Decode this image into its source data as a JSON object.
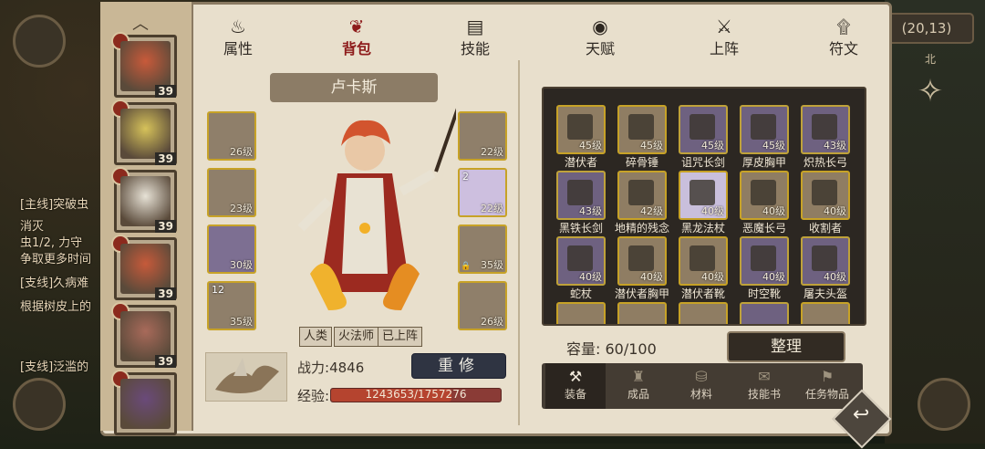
{
  "colors": {
    "gold_border": "#c7a227",
    "purple_slot": "#7d6f92",
    "active_tab": "#8e1c1c",
    "exp_bar": "#b5442f"
  },
  "hud": {
    "coordinates": "(20,13)",
    "north": "北"
  },
  "background_quests": [
    {
      "text": "[主线]突破虫",
      "cls": ""
    },
    {
      "text": "消灭",
      "cls": ""
    },
    {
      "text": "虫1/2, 力守",
      "cls": ""
    },
    {
      "text": "争取更多时间",
      "cls": ""
    },
    {
      "text": "[支线]久病难",
      "cls": ""
    },
    {
      "text": "根据树皮上的",
      "cls": ""
    },
    {
      "text": "[支线]泛滥的",
      "cls": ""
    }
  ],
  "tabs": [
    {
      "label": "属性",
      "icon": "flame-icon",
      "glyph": "♨",
      "active": false
    },
    {
      "label": "背包",
      "icon": "bag-icon",
      "glyph": "❦",
      "active": true
    },
    {
      "label": "技能",
      "icon": "book-icon",
      "glyph": "▤",
      "active": false
    },
    {
      "label": "天赋",
      "icon": "eye-icon",
      "glyph": "◉",
      "active": false
    },
    {
      "label": "上阵",
      "icon": "crossed-swords-icon",
      "glyph": "⚔",
      "active": false
    },
    {
      "label": "符文",
      "icon": "rune-icon",
      "glyph": "۩",
      "active": false
    }
  ],
  "heroes": [
    {
      "level": "39",
      "face_color": "#c85a3a"
    },
    {
      "level": "39",
      "face_color": "#d6c25a"
    },
    {
      "level": "39",
      "face_color": "#e7e2d6"
    },
    {
      "level": "39",
      "face_color": "#c65a3a"
    },
    {
      "level": "39",
      "face_color": "#a86a5a"
    },
    {
      "level": "",
      "face_color": "#6a4a7a"
    }
  ],
  "character": {
    "name": "卢卡斯",
    "tags": [
      "人类",
      "火法师",
      "已上阵"
    ],
    "power_label": "战力:",
    "power_value": "4846",
    "exp_label": "经验:",
    "exp_text": "1243653/1757276",
    "exp_ratio": 0.7077,
    "rebuild_button": "重修"
  },
  "equip_left": [
    {
      "level": "26级",
      "num": "",
      "style": "gold",
      "lock": false
    },
    {
      "level": "23级",
      "num": "",
      "style": "gold",
      "lock": false
    },
    {
      "level": "30级",
      "num": "",
      "style": "purple",
      "lock": false
    },
    {
      "level": "35级",
      "num": "12",
      "style": "gold",
      "lock": false
    }
  ],
  "equip_right": [
    {
      "level": "22级",
      "num": "",
      "style": "gold",
      "lock": false
    },
    {
      "level": "22级",
      "num": "2",
      "style": "lavender",
      "lock": false
    },
    {
      "level": "35级",
      "num": "",
      "style": "gold",
      "lock": true
    },
    {
      "level": "26级",
      "num": "",
      "style": "gold",
      "lock": false
    }
  ],
  "inventory": {
    "items": [
      {
        "name": "潜伏者",
        "level": "45级",
        "style": "gold"
      },
      {
        "name": "碎骨锤",
        "level": "45级",
        "style": "gold"
      },
      {
        "name": "诅咒长剑",
        "level": "45级",
        "style": "purple"
      },
      {
        "name": "厚皮胸甲",
        "level": "45级",
        "style": "purple"
      },
      {
        "name": "炽热长弓",
        "level": "43级",
        "style": "purple"
      },
      {
        "name": "黑铁长剑",
        "level": "43级",
        "style": "purple"
      },
      {
        "name": "地精的残念",
        "level": "42级",
        "style": "gold"
      },
      {
        "name": "黑龙法杖",
        "level": "40级",
        "style": "lav"
      },
      {
        "name": "恶魔长弓",
        "level": "40级",
        "style": "gold"
      },
      {
        "name": "收割者",
        "level": "40级",
        "style": "gold"
      },
      {
        "name": "蛇杖",
        "level": "40级",
        "style": "purple"
      },
      {
        "name": "潜伏者胸甲",
        "level": "40级",
        "style": "gold"
      },
      {
        "name": "潜伏者靴",
        "level": "40级",
        "style": "gold"
      },
      {
        "name": "时空靴",
        "level": "40级",
        "style": "purple"
      },
      {
        "name": "屠夫头盔",
        "level": "40级",
        "style": "purple"
      }
    ],
    "capacity_label": "容量:",
    "capacity_value": "60/100",
    "sort_button": "整理"
  },
  "subtabs": [
    {
      "label": "装备",
      "icon": "anvil-icon",
      "glyph": "⚒",
      "active": true
    },
    {
      "label": "成品",
      "icon": "pouch-icon",
      "glyph": "♜",
      "active": false
    },
    {
      "label": "材料",
      "icon": "sack-icon",
      "glyph": "⛁",
      "active": false
    },
    {
      "label": "技能书",
      "icon": "scroll-icon",
      "glyph": "✉",
      "active": false
    },
    {
      "label": "任务物品",
      "icon": "task-icon",
      "glyph": "⚑",
      "active": false
    }
  ]
}
